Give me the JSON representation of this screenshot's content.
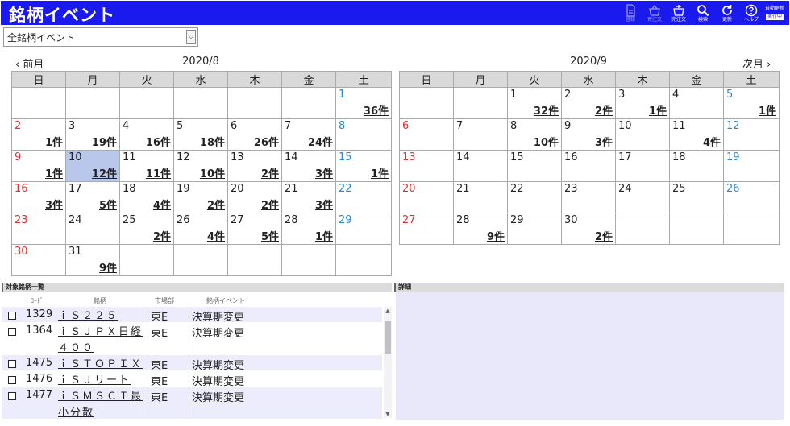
{
  "header": {
    "title": "銘柄イベント",
    "toolbar": [
      {
        "label": "登録",
        "icon": "register-icon",
        "disabled": true
      },
      {
        "label": "買注文",
        "icon": "buy-order-icon",
        "disabled": true
      },
      {
        "label": "売注文",
        "icon": "sell-order-icon",
        "disabled": false
      },
      {
        "label": "検索",
        "icon": "search-icon",
        "disabled": false
      },
      {
        "label": "更新",
        "icon": "refresh-icon",
        "disabled": false
      },
      {
        "label": "ヘルプ",
        "icon": "help-icon",
        "disabled": false
      }
    ],
    "auto_refresh": {
      "label": "自動更新",
      "state": "実行中"
    }
  },
  "filter": {
    "selected": "全銘柄イベント"
  },
  "calendar_left": {
    "prev_label": "前月",
    "month": "2020/8",
    "weekdays": [
      "日",
      "月",
      "火",
      "水",
      "木",
      "金",
      "土"
    ],
    "weeks": [
      [
        null,
        null,
        null,
        null,
        null,
        null,
        {
          "d": "1",
          "c": "36件"
        }
      ],
      [
        {
          "d": "2",
          "c": "1件"
        },
        {
          "d": "3",
          "c": "19件"
        },
        {
          "d": "4",
          "c": "16件"
        },
        {
          "d": "5",
          "c": "18件"
        },
        {
          "d": "6",
          "c": "26件"
        },
        {
          "d": "7",
          "c": "24件"
        },
        {
          "d": "8",
          "c": ""
        }
      ],
      [
        {
          "d": "9",
          "c": "1件"
        },
        {
          "d": "10",
          "c": "12件",
          "selected": true
        },
        {
          "d": "11",
          "c": "11件"
        },
        {
          "d": "12",
          "c": "10件"
        },
        {
          "d": "13",
          "c": "2件"
        },
        {
          "d": "14",
          "c": "3件"
        },
        {
          "d": "15",
          "c": "1件"
        }
      ],
      [
        {
          "d": "16",
          "c": "3件"
        },
        {
          "d": "17",
          "c": "5件"
        },
        {
          "d": "18",
          "c": "4件"
        },
        {
          "d": "19",
          "c": "2件"
        },
        {
          "d": "20",
          "c": "2件"
        },
        {
          "d": "21",
          "c": "3件"
        },
        {
          "d": "22",
          "c": ""
        }
      ],
      [
        {
          "d": "23",
          "c": ""
        },
        {
          "d": "24",
          "c": ""
        },
        {
          "d": "25",
          "c": "2件"
        },
        {
          "d": "26",
          "c": "4件"
        },
        {
          "d": "27",
          "c": "5件"
        },
        {
          "d": "28",
          "c": "1件"
        },
        {
          "d": "29",
          "c": ""
        }
      ],
      [
        {
          "d": "30",
          "c": ""
        },
        {
          "d": "31",
          "c": "9件"
        },
        null,
        null,
        null,
        null,
        null
      ]
    ]
  },
  "calendar_right": {
    "next_label": "次月",
    "month": "2020/9",
    "weekdays": [
      "日",
      "月",
      "火",
      "水",
      "木",
      "金",
      "土"
    ],
    "weeks": [
      [
        null,
        null,
        {
          "d": "1",
          "c": "32件"
        },
        {
          "d": "2",
          "c": "2件"
        },
        {
          "d": "3",
          "c": "1件"
        },
        {
          "d": "4",
          "c": ""
        },
        {
          "d": "5",
          "c": "1件"
        }
      ],
      [
        {
          "d": "6",
          "c": ""
        },
        {
          "d": "7",
          "c": ""
        },
        {
          "d": "8",
          "c": "10件"
        },
        {
          "d": "9",
          "c": "3件"
        },
        {
          "d": "10",
          "c": ""
        },
        {
          "d": "11",
          "c": "4件"
        },
        {
          "d": "12",
          "c": ""
        }
      ],
      [
        {
          "d": "13",
          "c": ""
        },
        {
          "d": "14",
          "c": ""
        },
        {
          "d": "15",
          "c": ""
        },
        {
          "d": "16",
          "c": ""
        },
        {
          "d": "17",
          "c": ""
        },
        {
          "d": "18",
          "c": ""
        },
        {
          "d": "19",
          "c": ""
        }
      ],
      [
        {
          "d": "20",
          "c": ""
        },
        {
          "d": "21",
          "c": ""
        },
        {
          "d": "22",
          "c": ""
        },
        {
          "d": "23",
          "c": ""
        },
        {
          "d": "24",
          "c": ""
        },
        {
          "d": "25",
          "c": ""
        },
        {
          "d": "26",
          "c": ""
        }
      ],
      [
        {
          "d": "27",
          "c": ""
        },
        {
          "d": "28",
          "c": "9件"
        },
        {
          "d": "29",
          "c": ""
        },
        {
          "d": "30",
          "c": "2件"
        },
        null,
        null,
        null
      ]
    ]
  },
  "list_panel": {
    "title": "対象銘柄一覧",
    "columns": [
      "ｺｰﾄﾞ",
      "銘柄",
      "市場部",
      "銘柄イベント"
    ],
    "rows": [
      {
        "code": "1329",
        "name": "ｉＳ２２５",
        "market": "東E",
        "event": "決算期変更"
      },
      {
        "code": "1364",
        "name": "ｉＳＪＰＸ日経４００",
        "market": "東E",
        "event": "決算期変更"
      },
      {
        "code": "1475",
        "name": "ｉＳＴＯＰＩＸ",
        "market": "東E",
        "event": "決算期変更"
      },
      {
        "code": "1476",
        "name": "ｉＳＪリート",
        "market": "東E",
        "event": "決算期変更"
      },
      {
        "code": "1477",
        "name": "ｉＳＭＳＣＩ最小分散",
        "market": "東E",
        "event": "決算期変更"
      }
    ]
  },
  "detail_panel": {
    "title": "詳細"
  },
  "colors": {
    "header_bg": "#1a1aee",
    "sunday": "#e03030",
    "saturday": "#2a88d0",
    "selected_cell": "#b9c8ea",
    "alt_row": "#ececfc",
    "detail_bg": "#e8e8fa"
  }
}
